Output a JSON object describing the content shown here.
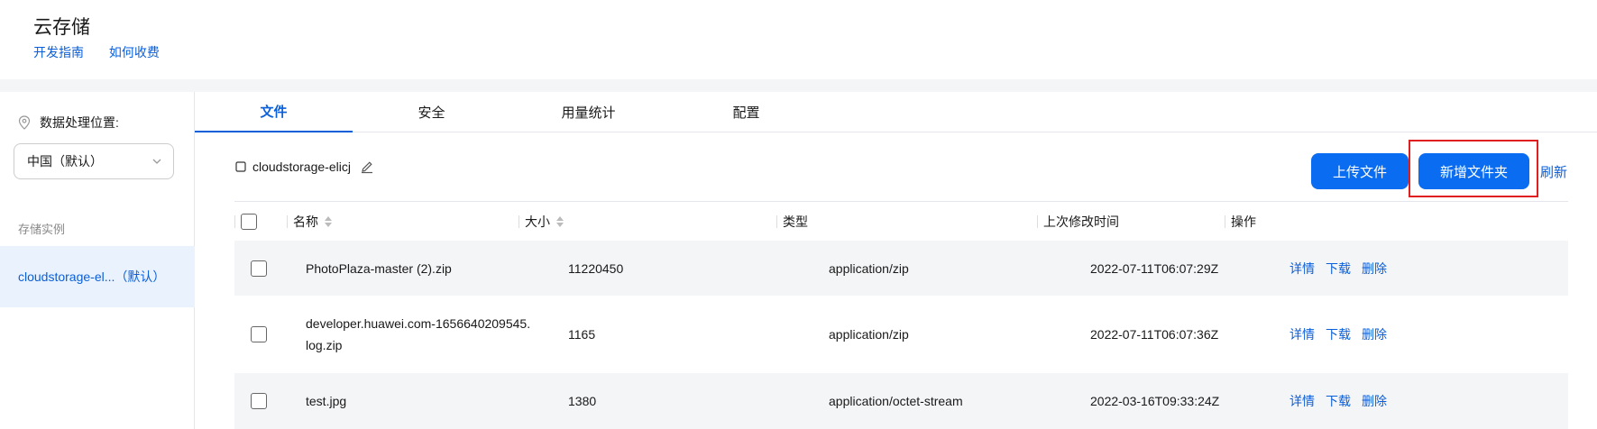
{
  "header": {
    "title": "云存储",
    "links": [
      "开发指南",
      "如何收费"
    ]
  },
  "sidebar": {
    "region_label": "数据处理位置:",
    "region_value": "中国（默认）",
    "instances_label": "存储实例",
    "instance_selected": "cloudstorage-el...（默认）"
  },
  "tabs": [
    "文件",
    "安全",
    "用量统计",
    "配置"
  ],
  "bucket_name": "cloudstorage-elicj",
  "toolbar": {
    "upload_label": "上传文件",
    "new_folder_label": "新增文件夹",
    "refresh_label": "刷新"
  },
  "table": {
    "columns": [
      "名称",
      "大小",
      "类型",
      "上次修改时间",
      "操作"
    ],
    "rows": [
      {
        "name": "PhotoPlaza-master (2).zip",
        "size": "11220450",
        "type": "application/zip",
        "modified": "2022-07-11T06:07:29Z"
      },
      {
        "name": "developer.huawei.com-1656640209545.log.zip",
        "size": "1165",
        "type": "application/zip",
        "modified": "2022-07-11T06:07:36Z"
      },
      {
        "name": "test.jpg",
        "size": "1380",
        "type": "application/octet-stream",
        "modified": "2022-03-16T09:33:24Z"
      }
    ],
    "actions": [
      "详情",
      "下载",
      "删除"
    ]
  },
  "colors": {
    "accent": "#0a6cf0",
    "link": "#0a5fd9",
    "highlight": "#e02020"
  }
}
